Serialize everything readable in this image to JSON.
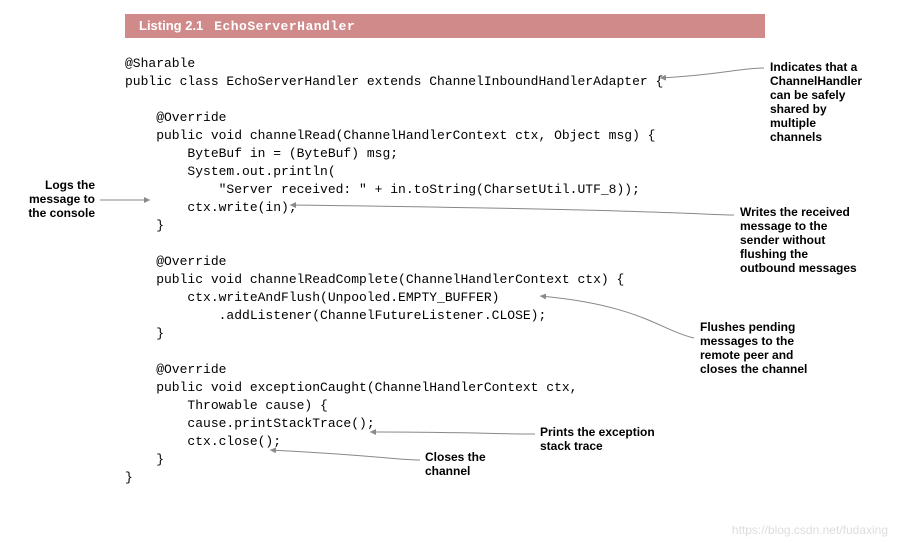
{
  "listing": {
    "number": "Listing 2.1",
    "title": "EchoServerHandler"
  },
  "code": {
    "l1": "@Sharable",
    "l2": "public class EchoServerHandler extends ChannelInboundHandlerAdapter {",
    "l3": "",
    "l4": "    @Override",
    "l5": "    public void channelRead(ChannelHandlerContext ctx, Object msg) {",
    "l6": "        ByteBuf in = (ByteBuf) msg;",
    "l7": "        System.out.println(",
    "l8": "            \"Server received: \" + in.toString(CharsetUtil.UTF_8));",
    "l9": "        ctx.write(in);",
    "l10": "    }",
    "l11": "",
    "l12": "    @Override",
    "l13": "    public void channelReadComplete(ChannelHandlerContext ctx) {",
    "l14": "        ctx.writeAndFlush(Unpooled.EMPTY_BUFFER)",
    "l15": "            .addListener(ChannelFutureListener.CLOSE);",
    "l16": "    }",
    "l17": "",
    "l18": "    @Override",
    "l19": "    public void exceptionCaught(ChannelHandlerContext ctx,",
    "l20": "        Throwable cause) {",
    "l21": "        cause.printStackTrace();",
    "l22": "        ctx.close();",
    "l23": "    }",
    "l24": "}"
  },
  "annotations": {
    "sharable": "Indicates that a\nChannelHandler\ncan be safely\nshared by\nmultiple\nchannels",
    "logs": "Logs the\nmessage to\nthe console",
    "write": "Writes the received\nmessage to the\nsender without\nflushing the\noutbound messages",
    "flush": "Flushes pending\nmessages to the\nremote peer and\ncloses the channel",
    "close": "Closes the\nchannel",
    "stack": "Prints the exception\nstack trace"
  },
  "watermark": "https://blog.csdn.net/fudaxing"
}
